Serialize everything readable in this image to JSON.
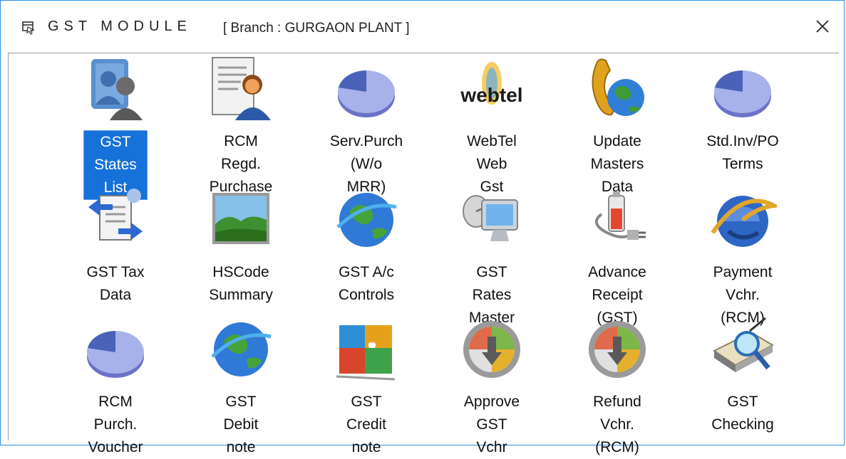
{
  "window": {
    "title": "GST MODULE",
    "branch": "[ Branch : GURGAON PLANT ]",
    "close_symbol": "✕"
  },
  "items": [
    {
      "label": "GST States\nList",
      "icon": "users-group-icon",
      "selected": true
    },
    {
      "label": "RCM Regd.\nPurchase",
      "icon": "document-person-icon"
    },
    {
      "label": "Serv.Purch\n(W/o MRR)",
      "icon": "pie-chart-icon"
    },
    {
      "label": "WebTel Web\nGst",
      "icon": "webtel-logo-icon",
      "logo_text": "webtel"
    },
    {
      "label": "Update\nMasters Data",
      "icon": "phone-globe-icon"
    },
    {
      "label": "Std.Inv/PO\nTerms",
      "icon": "pie-chart-icon"
    },
    {
      "label": "GST Tax Data",
      "icon": "document-refresh-icon"
    },
    {
      "label": "HSCode\nSummary",
      "icon": "landscape-picture-icon"
    },
    {
      "label": "GST A/c\nControls",
      "icon": "globe-icon"
    },
    {
      "label": "GST Rates\nMaster",
      "icon": "computer-satellite-icon"
    },
    {
      "label": "Advance\nReceipt (GST)",
      "icon": "battery-plug-icon"
    },
    {
      "label": "Payment Vchr.\n(RCM)",
      "icon": "ie-globe-icon"
    },
    {
      "label": "RCM Purch.\nVoucher",
      "icon": "pie-chart-icon"
    },
    {
      "label": "GST Debit\nnote",
      "icon": "globe-icon"
    },
    {
      "label": "GST Credit\nnote",
      "icon": "puzzle-icon"
    },
    {
      "label": "Approve GST\nVchr",
      "icon": "gauge-download-icon"
    },
    {
      "label": "Refund Vchr.\n(RCM)",
      "icon": "gauge-download-icon"
    },
    {
      "label": "GST Checking",
      "icon": "scanner-magnifier-icon"
    }
  ]
}
